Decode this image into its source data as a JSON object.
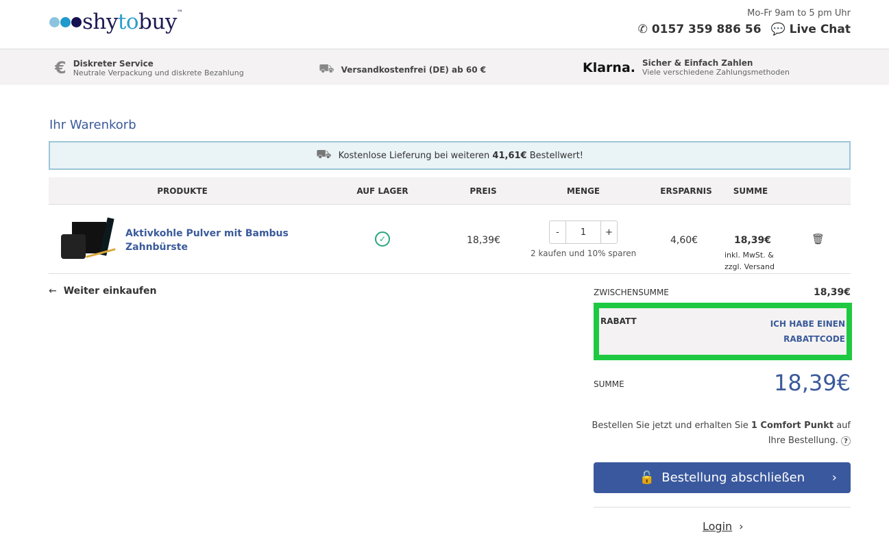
{
  "brand": {
    "name_a": "shy",
    "name_b": "to",
    "name_c": "buy",
    "tm": "™",
    "dot_colors": [
      "#8cc4e0",
      "#1e9acb",
      "#15104f"
    ]
  },
  "header": {
    "hours": "Mo-Fr 9am to 5 pm Uhr",
    "phone": "0157 359 886 56",
    "chat": "Live Chat"
  },
  "features": [
    {
      "title": "Diskreter Service",
      "sub": "Neutrale Verpackung und diskrete Bezahlung",
      "icon": "euro-icon"
    },
    {
      "title": "Versandkostenfrei (DE) ab 60 €",
      "icon": "truck-icon"
    },
    {
      "title": "Sicher & Einfach Zahlen",
      "sub": "Viele verschiedene Zahlungsmethoden",
      "logo": "Klarna."
    }
  ],
  "cart": {
    "title": "Ihr Warenkorb",
    "notice_pre": "Kostenlose Lieferung bei weiteren ",
    "notice_amount": "41,61€",
    "notice_post": " Bestellwert!",
    "columns": [
      "PRODUKTE",
      "AUF LAGER",
      "PREIS",
      "MENGE",
      "ERSPARNIS",
      "SUMME"
    ],
    "item": {
      "name": "Aktivkohle Pulver mit Bambus Zahnbürste",
      "price": "18,39€",
      "qty": "1",
      "minus": "-",
      "plus": "+",
      "offer": "2 kaufen und 10% sparen",
      "saving": "4,60€",
      "sum": "18,39€",
      "tax": "inkl. MwSt. &",
      "ship": "zzgl. Versand"
    },
    "continue": "Weiter einkaufen",
    "subtotal_label": "ZWISCHENSUMME",
    "subtotal": "18,39€",
    "discount_label": "RABATT",
    "discount_link_1": "ICH HABE EINEN",
    "discount_link_2": "RABATTCODE",
    "total_label": "SUMME",
    "total": "18,39€",
    "points_pre": "Bestellen Sie jetzt und erhalten Sie ",
    "points_bold": "1 Comfort Punkt",
    "points_post": " auf",
    "points_line2": "Ihre Bestellung.",
    "checkout": "Bestellung abschließen",
    "login": "Login"
  }
}
